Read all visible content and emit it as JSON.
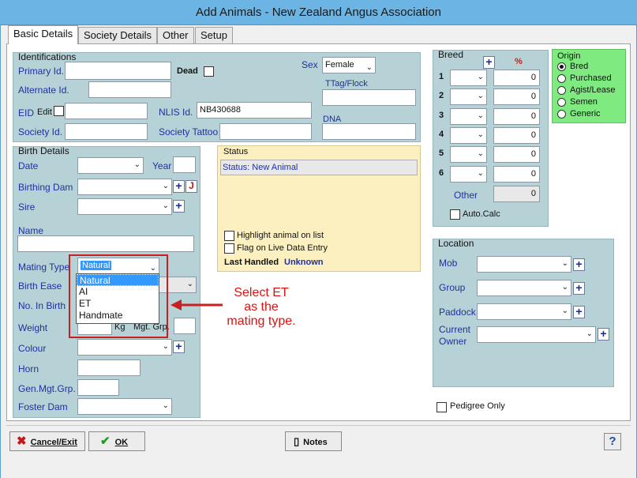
{
  "window": {
    "title": "Add Animals - New Zealand Angus Association"
  },
  "tabs": [
    "Basic Details",
    "Society Details",
    "Other",
    "Setup"
  ],
  "identifications": {
    "title": "Identifications",
    "primary_id_label": "Primary Id.",
    "primary_id": "",
    "dead_label": "Dead",
    "alternate_id_label": "Alternate Id.",
    "alternate_id": "",
    "eid_label": "EID",
    "eid_edit_label": "Edit",
    "eid": "",
    "nlis_label": "NLIS Id.",
    "nlis_id": "NB430688",
    "society_id_label": "Society Id.",
    "society_id": "",
    "society_tattoo_label": "Society Tattoo",
    "society_tattoo": "",
    "sex_label": "Sex",
    "sex": "Female",
    "ttag_label": "TTag/Flock",
    "dna_label": "DNA"
  },
  "birth": {
    "title": "Birth Details",
    "date_label": "Date",
    "year_label": "Year",
    "birthing_dam_label": "Birthing Dam",
    "sire_label": "Sire",
    "name_label": "Name",
    "mating_type_label": "Mating Type",
    "mating_type": "Natural",
    "birth_ease_label": "Birth Ease",
    "no_in_birth_label": "No. In Birth",
    "weight_label": "Weight",
    "kg_label": "Kg",
    "mgt_grp_label": "Mgt. Grp.",
    "colour_label": "Colour",
    "horn_label": "Horn",
    "gen_mgt_grp_label": "Gen.Mgt.Grp.",
    "foster_dam_label": "Foster Dam",
    "j_label": "J"
  },
  "mating_options": [
    "Natural",
    "AI",
    "ET",
    "Handmate"
  ],
  "annotation": {
    "line1": "Select ET",
    "line2": "as the",
    "line3": "mating type."
  },
  "status": {
    "title": "Status",
    "value": "Status: New Animal",
    "highlight_label": "Highlight animal on list",
    "flag_label": "Flag on Live Data Entry",
    "last_handled_label": "Last Handled",
    "last_handled_value": "Unknown"
  },
  "breed": {
    "title": "Breed",
    "pct_label": "%",
    "rows": [
      {
        "n": "1",
        "pct": "0"
      },
      {
        "n": "2",
        "pct": "0"
      },
      {
        "n": "3",
        "pct": "0"
      },
      {
        "n": "4",
        "pct": "0"
      },
      {
        "n": "5",
        "pct": "0"
      },
      {
        "n": "6",
        "pct": "0"
      }
    ],
    "other_label": "Other",
    "other_value": "0",
    "autocalc_label": "Auto.Calc"
  },
  "origin": {
    "title": "Origin",
    "options": [
      "Bred",
      "Purchased",
      "Agist/Lease",
      "Semen",
      "Generic"
    ],
    "selected": "Bred"
  },
  "location": {
    "title": "Location",
    "mob_label": "Mob",
    "group_label": "Group",
    "paddock_label": "Paddock",
    "owner_label1": "Current",
    "owner_label2": "Owner"
  },
  "pedigree_label": "Pedigree Only",
  "buttons": {
    "cancel": "Cancel/Exit",
    "ok": "OK",
    "notes": "Notes",
    "help": "?"
  },
  "colors": {
    "group_bg": "#b7d2d6",
    "status_bg": "#fcf0c0",
    "origin_bg": "#7fea7f",
    "accent": "#3399ff",
    "annotation": "#e01010"
  }
}
